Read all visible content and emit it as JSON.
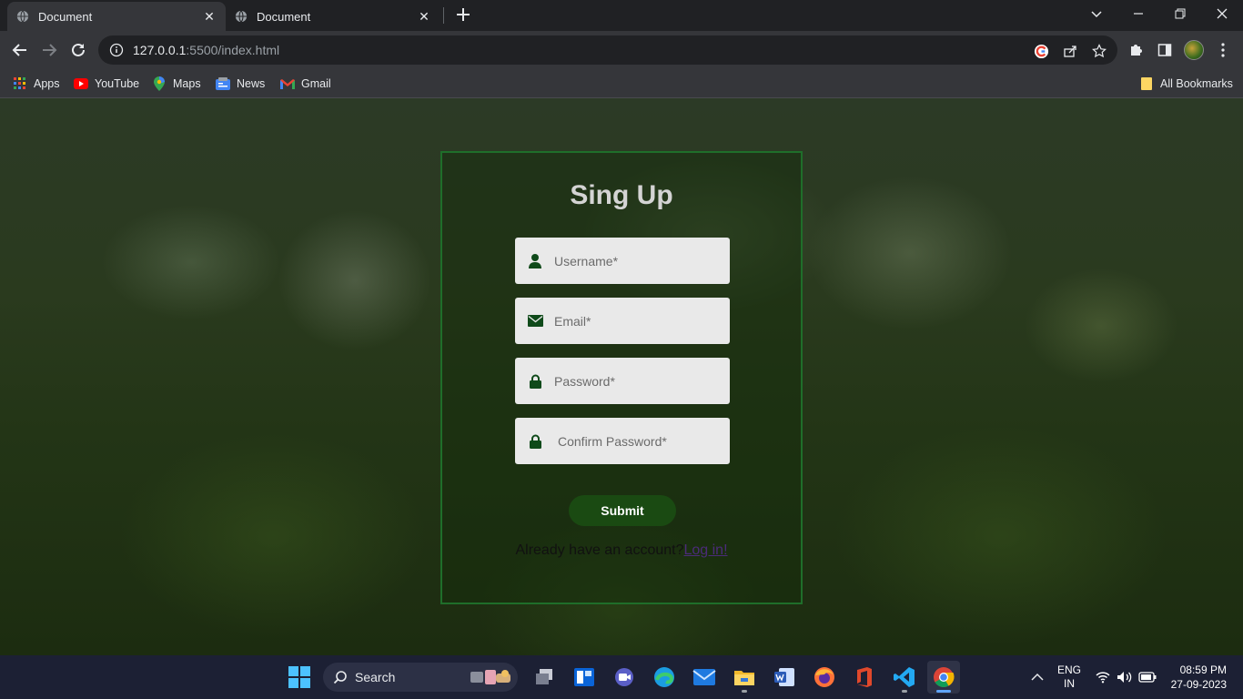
{
  "browser": {
    "tabs": [
      {
        "title": "Document",
        "active": true
      },
      {
        "title": "Document",
        "active": false
      }
    ],
    "url_host": "127.0.0.1",
    "url_rest": ":5500/index.html",
    "bookmarks": [
      {
        "label": "Apps",
        "icon": "apps-grid-icon"
      },
      {
        "label": "YouTube",
        "icon": "youtube-icon"
      },
      {
        "label": "Maps",
        "icon": "maps-icon"
      },
      {
        "label": "News",
        "icon": "news-icon"
      },
      {
        "label": "Gmail",
        "icon": "gmail-icon"
      }
    ],
    "all_bookmarks": "All Bookmarks"
  },
  "page": {
    "title": "Sing Up",
    "fields": [
      {
        "placeholder": "Username*",
        "icon": "user-icon"
      },
      {
        "placeholder": "Email*",
        "icon": "envelope-icon"
      },
      {
        "placeholder": "Password*",
        "icon": "lock-icon"
      },
      {
        "placeholder": "Confirm Password*",
        "icon": "lock-icon"
      }
    ],
    "submit_label": "Submit",
    "already_text": "Already have an account?",
    "login_link": "Log in!"
  },
  "taskbar": {
    "search_label": "Search",
    "lang_line1": "ENG",
    "lang_line2": "IN",
    "time": "08:59 PM",
    "date": "27-09-2023"
  },
  "colors": {
    "accent_green": "#1a4a12",
    "card_border": "#1f6e2a",
    "title_color": "#d4d4d4",
    "icon_green": "#0f4a1a"
  }
}
